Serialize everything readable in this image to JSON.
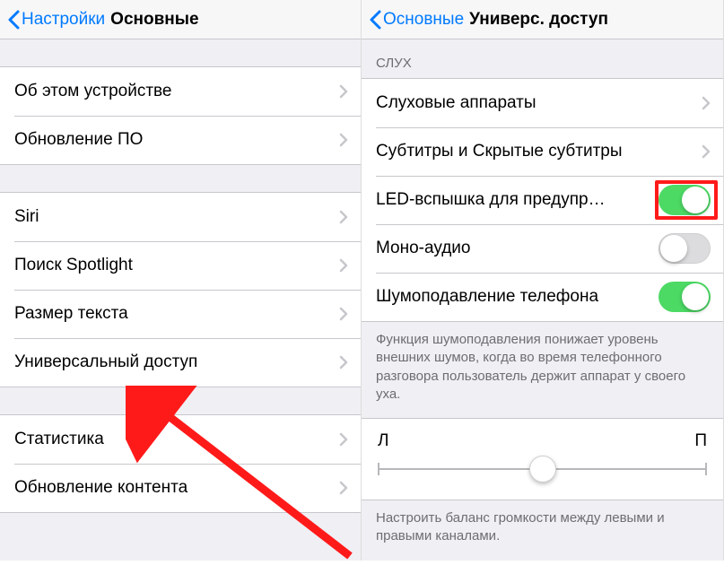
{
  "left": {
    "back_label": "Настройки",
    "title": "Основные",
    "group1": [
      {
        "label": "Об этом устройстве"
      },
      {
        "label": "Обновление ПО"
      }
    ],
    "group2": [
      {
        "label": "Siri"
      },
      {
        "label": "Поиск Spotlight"
      },
      {
        "label": "Размер текста"
      },
      {
        "label": "Универсальный доступ"
      }
    ],
    "group3": [
      {
        "label": "Статистика"
      },
      {
        "label": "Обновление контента"
      }
    ]
  },
  "right": {
    "back_label": "Основные",
    "title": "Универс. доступ",
    "section_header": "СЛУХ",
    "rows": [
      {
        "label": "Слуховые аппараты",
        "type": "disclosure"
      },
      {
        "label": "Субтитры и Скрытые субтитры",
        "type": "disclosure"
      },
      {
        "label": "LED-вспышка для предупр…",
        "type": "toggle",
        "on": true,
        "highlight": true
      },
      {
        "label": "Моно-аудио",
        "type": "toggle",
        "on": false
      },
      {
        "label": "Шумоподавление телефона",
        "type": "toggle",
        "on": true
      }
    ],
    "footer1": "Функция шумоподавления понижает уровень внешних шумов, когда во время телефонного разговора пользователь держит аппарат у своего уха.",
    "slider": {
      "left_label": "Л",
      "right_label": "П",
      "position": 0.5
    },
    "footer2": "Настроить баланс громкости между левыми и правыми каналами."
  }
}
